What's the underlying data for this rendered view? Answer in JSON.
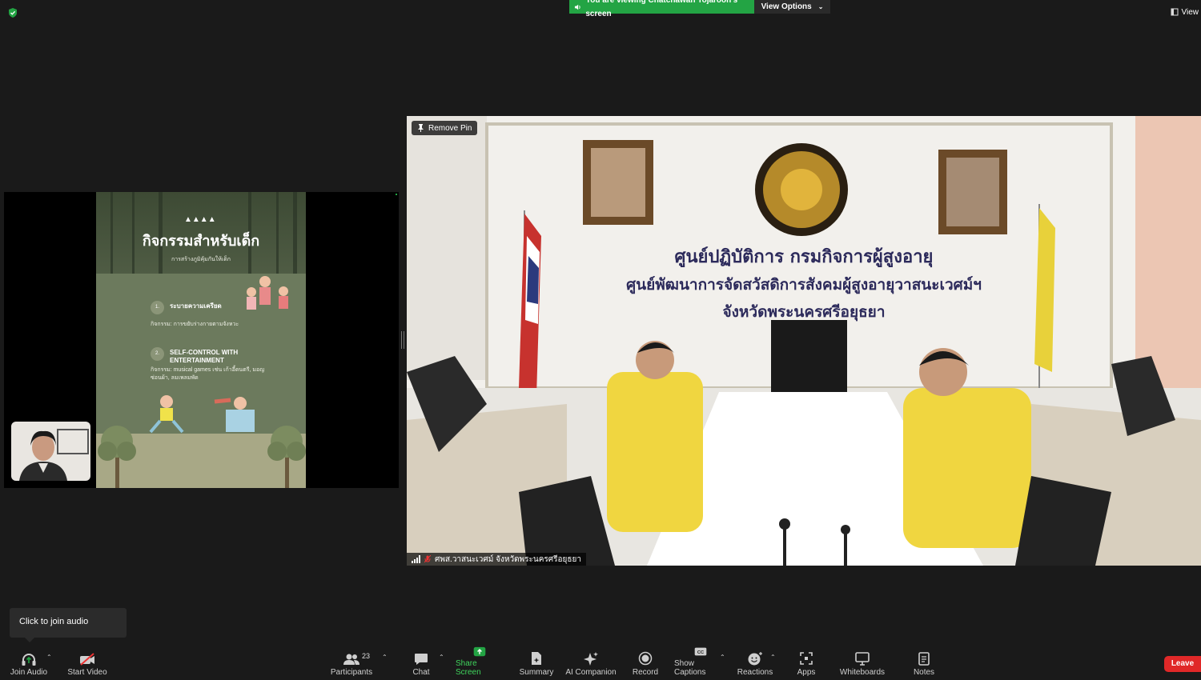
{
  "banner": {
    "viewing_text": "You are viewing Chatchawan Tojaroon's screen",
    "view_options": "View Options",
    "view_label": "View"
  },
  "slide": {
    "title": "กิจกรรมสำหรับเด็ก",
    "subtitle": "การสร้างภูมิคุ้มกันให้เด็ก",
    "items": [
      {
        "num": "1.",
        "title": "ระบายความเครียด",
        "desc": "กิจกรรม: การขยับร่างกายตามจังหวะ"
      },
      {
        "num": "2.",
        "title": "SELF-CONTROL WITH ENTERTAINMENT",
        "desc": "กิจกรรม: musical games เช่น เก้าอี้ดนตรี, มอญซ่อนผ้า, ลมเพลมพัด"
      }
    ]
  },
  "main_video": {
    "remove_pin": "Remove Pin",
    "sign_lines": [
      "ศูนย์ปฏิบัติการ กรมกิจการผู้สูงอายุ",
      "ศูนย์พัฒนาการจัดสวัสดิการสังคมผู้สูงอายุวาสนะเวศม์ฯ",
      "จังหวัดพระนครศรีอยุธยา"
    ],
    "participant_name": "ศพส.วาสนะเวศม์ จังหวัดพระนครศรีอยุธยา"
  },
  "audio_tip": "Click to join audio",
  "toolbar": {
    "join_audio": "Join Audio",
    "start_video": "Start Video",
    "participants": "Participants",
    "participants_count": "23",
    "chat": "Chat",
    "share_screen": "Share Screen",
    "summary": "Summary",
    "ai_companion": "AI Companion",
    "record": "Record",
    "show_captions": "Show Captions",
    "reactions": "Reactions",
    "apps": "Apps",
    "whiteboards": "Whiteboards",
    "notes": "Notes",
    "leave": "Leave"
  },
  "colors": {
    "share_green": "#23a444",
    "leave_red": "#e02828",
    "background": "#1a1a1a"
  }
}
